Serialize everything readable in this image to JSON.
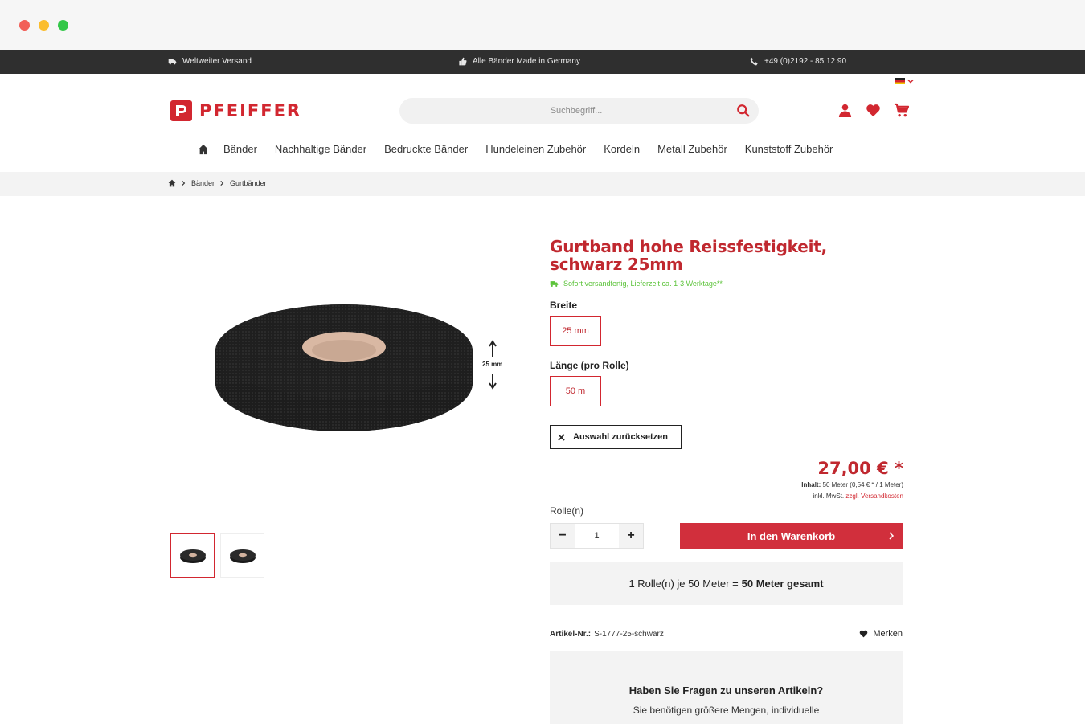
{
  "topbar": {
    "shipping": "Weltweiter Versand",
    "made_in": "Alle Bänder Made in Germany",
    "phone": "+49 (0)2192 - 85 12 90"
  },
  "header": {
    "logo": "PFEIFFER",
    "search_placeholder": "Suchbegriff...",
    "icons": [
      "account-icon",
      "heart-icon",
      "cart-icon"
    ],
    "language": "de-flag-icon"
  },
  "nav": {
    "items": [
      "Bänder",
      "Nachhaltige Bänder",
      "Bedruckte Bänder",
      "Hundeleinen Zubehör",
      "Kordeln",
      "Metall Zubehör",
      "Kunststoff Zubehör"
    ]
  },
  "breadcrumb": [
    "Bänder",
    "Gurtbänder"
  ],
  "gallery": {
    "dimension_label": "25 mm"
  },
  "product": {
    "title": "Gurtband hohe Reissfestigkeit, schwarz 25mm",
    "delivery": "Sofort versandfertig, Lieferzeit ca. 1-3 Werktage**",
    "width_label": "Breite",
    "width_value": "25 mm",
    "length_label": "Länge (pro Rolle)",
    "length_value": "50 m",
    "reset_label": "Auswahl zurücksetzen",
    "price": "27,00 € *",
    "content_label": "Inhalt:",
    "content_value": "50 Meter (0,54 € * / 1 Meter)",
    "tax_text": "inkl. MwSt.",
    "shipping_link": "zzgl. Versandkosten",
    "qty_label": "Rolle(n)",
    "qty_value": "1",
    "cart_button": "In den Warenkorb",
    "summary_prefix": "1 Rolle(n) je 50 Meter =",
    "summary_total": "50 Meter gesamt",
    "article_label": "Artikel-Nr.:",
    "article_number": "S-1777-25-schwarz",
    "merken": "Merken",
    "faq_question": "Haben Sie Fragen zu unseren Artikeln?",
    "faq_text": "Sie benötigen größere Mengen, individuelle"
  },
  "colors": {
    "brand": "#d22730",
    "topbar": "#2f2f2f",
    "delivery_green": "#5cc33a"
  }
}
